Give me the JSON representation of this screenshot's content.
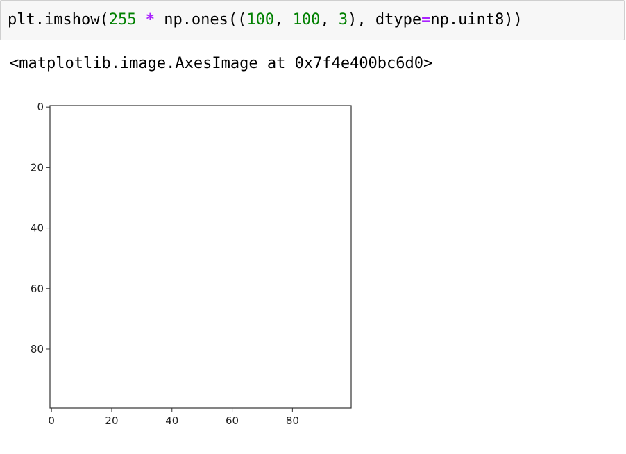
{
  "input_cell": {
    "tokens": [
      {
        "text": "plt.imshow(",
        "kind": "plain"
      },
      {
        "text": "255",
        "kind": "num"
      },
      {
        "text": " ",
        "kind": "plain"
      },
      {
        "text": "*",
        "kind": "op"
      },
      {
        "text": " np.ones((",
        "kind": "plain"
      },
      {
        "text": "100",
        "kind": "num"
      },
      {
        "text": ", ",
        "kind": "plain"
      },
      {
        "text": "100",
        "kind": "num"
      },
      {
        "text": ", ",
        "kind": "plain"
      },
      {
        "text": "3",
        "kind": "num"
      },
      {
        "text": "), dtype",
        "kind": "plain"
      },
      {
        "text": "=",
        "kind": "op"
      },
      {
        "text": "np.uint8))",
        "kind": "plain"
      }
    ]
  },
  "output": {
    "repr_text": "<matplotlib.image.AxesImage at 0x7f4e400bc6d0>"
  },
  "chart_data": {
    "type": "heatmap",
    "image_value": 255,
    "image_shape": [
      100,
      100,
      3
    ],
    "xlim": [
      -0.5,
      99.5
    ],
    "ylim": [
      99.5,
      -0.5
    ],
    "xticks": [
      0,
      20,
      40,
      60,
      80
    ],
    "yticks": [
      0,
      20,
      40,
      60,
      80
    ],
    "xtick_labels": [
      "0",
      "20",
      "40",
      "60",
      "80"
    ],
    "ytick_labels": [
      "0",
      "20",
      "40",
      "60",
      "80"
    ],
    "title": "",
    "xlabel": "",
    "ylabel": "",
    "grid": false,
    "image_color": "#ffffff",
    "axes_color": "#333333"
  }
}
